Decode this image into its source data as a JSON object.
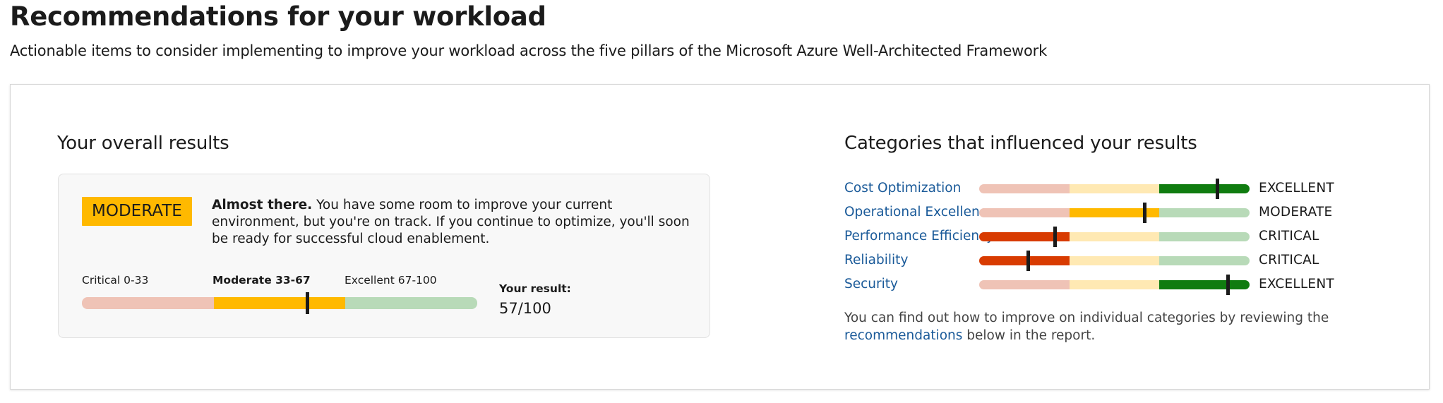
{
  "page": {
    "title": "Recommendations for your workload",
    "subtitle": "Actionable items to consider implementing to improve your workload across the five pillars of the Microsoft Azure Well-Architected Framework"
  },
  "overall": {
    "title": "Your overall results",
    "level": "MODERATE",
    "summary_bold": "Almost there.",
    "summary_text": " You have some room to improve your current environment, but you're on track. If you continue to optimize, you'll soon be ready for successful cloud enablement.",
    "ranges": [
      {
        "label": "Critical 0-33",
        "active": false
      },
      {
        "label": "Moderate 33-67",
        "active": true
      },
      {
        "label": "Excellent 67-100",
        "active": false
      }
    ],
    "result_label": "Your result:",
    "result_value": "57/100",
    "score": 57
  },
  "categories": {
    "title": "Categories that influenced your results",
    "items": [
      {
        "name": "Cost Optimization",
        "level": "EXCELLENT",
        "band": 2,
        "position": 0.88
      },
      {
        "name": "Operational Excellence",
        "level": "MODERATE",
        "band": 1,
        "position": 0.61
      },
      {
        "name": "Performance Efficiency",
        "level": "CRITICAL",
        "band": 0,
        "position": 0.28
      },
      {
        "name": "Reliability",
        "level": "CRITICAL",
        "band": 0,
        "position": 0.18
      },
      {
        "name": "Security",
        "level": "EXCELLENT",
        "band": 2,
        "position": 0.92
      }
    ],
    "footnote_before": "You can find out how to improve on individual categories by reviewing the ",
    "footnote_link": "recommendations",
    "footnote_after": " below in the report."
  },
  "colors": {
    "critical_active": "#d83b01",
    "critical_muted": "#efc3b6",
    "moderate_active": "#ffb900",
    "moderate_muted": "#ffe9b3",
    "excellent_active": "#107c10",
    "excellent_muted": "#b8dab8",
    "overall_moderate_muted": "#fce8b3",
    "link": "#1a5a99"
  }
}
